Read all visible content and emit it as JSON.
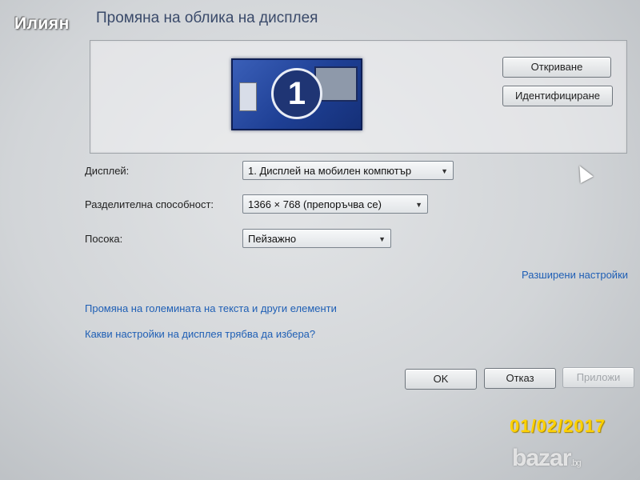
{
  "watermark_name": "Илиян",
  "window": {
    "title": "Промяна на облика на дисплея"
  },
  "preview": {
    "monitor_number": "1",
    "detect_label": "Откриване",
    "identify_label": "Идентифициране"
  },
  "settings": {
    "display_label": "Дисплей:",
    "display_value": "1. Дисплей на мобилен компютър",
    "resolution_label": "Разделителна способност:",
    "resolution_value": "1366 × 768 (препоръчва се)",
    "orientation_label": "Посока:",
    "orientation_value": "Пейзажно"
  },
  "links": {
    "advanced": "Разширени настройки",
    "text_size": "Промяна на големината на текста и други елементи",
    "help": "Какви настройки на дисплея трябва да избера?"
  },
  "buttons": {
    "ok": "OK",
    "cancel": "Отказ",
    "apply": "Приложи"
  },
  "photo": {
    "date_stamp": "01/02/2017"
  },
  "logo": {
    "text": "bazar",
    "suffix": ".bg"
  }
}
